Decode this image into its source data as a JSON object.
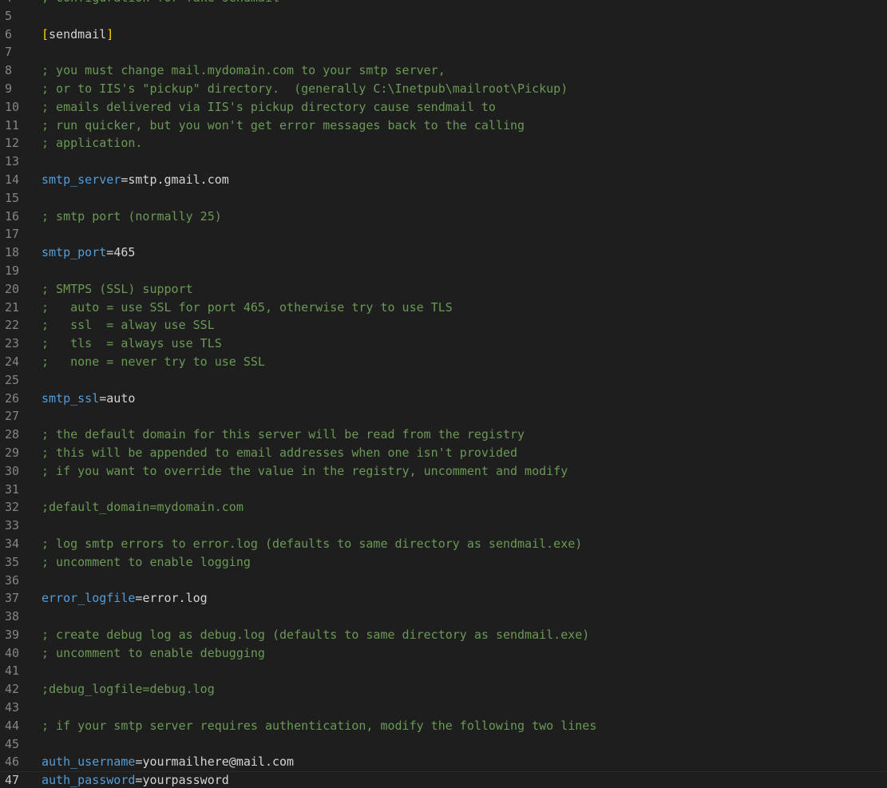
{
  "editor": {
    "language": "ini",
    "current_line": "47",
    "lines": [
      {
        "num": "4",
        "kind": "comment",
        "text": "; configuration for fake sendmail"
      },
      {
        "num": "5",
        "kind": "blank"
      },
      {
        "num": "6",
        "kind": "section",
        "open": "[",
        "name": "sendmail",
        "close": "]"
      },
      {
        "num": "7",
        "kind": "blank"
      },
      {
        "num": "8",
        "kind": "comment",
        "text": "; you must change mail.mydomain.com to your smtp server,"
      },
      {
        "num": "9",
        "kind": "comment",
        "text": "; or to IIS's \"pickup\" directory.  (generally C:\\Inetpub\\mailroot\\Pickup)"
      },
      {
        "num": "10",
        "kind": "comment",
        "text": "; emails delivered via IIS's pickup directory cause sendmail to"
      },
      {
        "num": "11",
        "kind": "comment",
        "text": "; run quicker, but you won't get error messages back to the calling"
      },
      {
        "num": "12",
        "kind": "comment",
        "text": "; application."
      },
      {
        "num": "13",
        "kind": "blank"
      },
      {
        "num": "14",
        "kind": "setting",
        "key": "smtp_server",
        "eq": "=",
        "value": "smtp.gmail.com"
      },
      {
        "num": "15",
        "kind": "blank"
      },
      {
        "num": "16",
        "kind": "comment",
        "text": "; smtp port (normally 25)"
      },
      {
        "num": "17",
        "kind": "blank"
      },
      {
        "num": "18",
        "kind": "setting",
        "key": "smtp_port",
        "eq": "=",
        "value": "465"
      },
      {
        "num": "19",
        "kind": "blank"
      },
      {
        "num": "20",
        "kind": "comment",
        "text": "; SMTPS (SSL) support"
      },
      {
        "num": "21",
        "kind": "comment",
        "text": ";   auto = use SSL for port 465, otherwise try to use TLS"
      },
      {
        "num": "22",
        "kind": "comment",
        "text": ";   ssl  = alway use SSL"
      },
      {
        "num": "23",
        "kind": "comment",
        "text": ";   tls  = always use TLS"
      },
      {
        "num": "24",
        "kind": "comment",
        "text": ";   none = never try to use SSL"
      },
      {
        "num": "25",
        "kind": "blank"
      },
      {
        "num": "26",
        "kind": "setting",
        "key": "smtp_ssl",
        "eq": "=",
        "value": "auto"
      },
      {
        "num": "27",
        "kind": "blank"
      },
      {
        "num": "28",
        "kind": "comment",
        "text": "; the default domain for this server will be read from the registry"
      },
      {
        "num": "29",
        "kind": "comment",
        "text": "; this will be appended to email addresses when one isn't provided"
      },
      {
        "num": "30",
        "kind": "comment",
        "text": "; if you want to override the value in the registry, uncomment and modify"
      },
      {
        "num": "31",
        "kind": "blank"
      },
      {
        "num": "32",
        "kind": "comment",
        "text": ";default_domain=mydomain.com"
      },
      {
        "num": "33",
        "kind": "blank"
      },
      {
        "num": "34",
        "kind": "comment",
        "text": "; log smtp errors to error.log (defaults to same directory as sendmail.exe)"
      },
      {
        "num": "35",
        "kind": "comment",
        "text": "; uncomment to enable logging"
      },
      {
        "num": "36",
        "kind": "blank"
      },
      {
        "num": "37",
        "kind": "setting",
        "key": "error_logfile",
        "eq": "=",
        "value": "error.log"
      },
      {
        "num": "38",
        "kind": "blank"
      },
      {
        "num": "39",
        "kind": "comment",
        "text": "; create debug log as debug.log (defaults to same directory as sendmail.exe)"
      },
      {
        "num": "40",
        "kind": "comment",
        "text": "; uncomment to enable debugging"
      },
      {
        "num": "41",
        "kind": "blank"
      },
      {
        "num": "42",
        "kind": "comment",
        "text": ";debug_logfile=debug.log"
      },
      {
        "num": "43",
        "kind": "blank"
      },
      {
        "num": "44",
        "kind": "comment",
        "text": "; if your smtp server requires authentication, modify the following two lines"
      },
      {
        "num": "45",
        "kind": "blank"
      },
      {
        "num": "46",
        "kind": "setting",
        "key": "auth_username",
        "eq": "=",
        "value": "yourmailhere@mail.com"
      },
      {
        "num": "47",
        "kind": "setting",
        "key": "auth_password",
        "eq": "=",
        "value": "yourpassword"
      }
    ]
  },
  "colors": {
    "background": "#1e1e1e",
    "line_number": "#858585",
    "line_number_active": "#c6c6c6",
    "comment": "#6a9955",
    "key": "#569cd6",
    "text": "#d4d4d4",
    "bracket": "#ffd700"
  }
}
